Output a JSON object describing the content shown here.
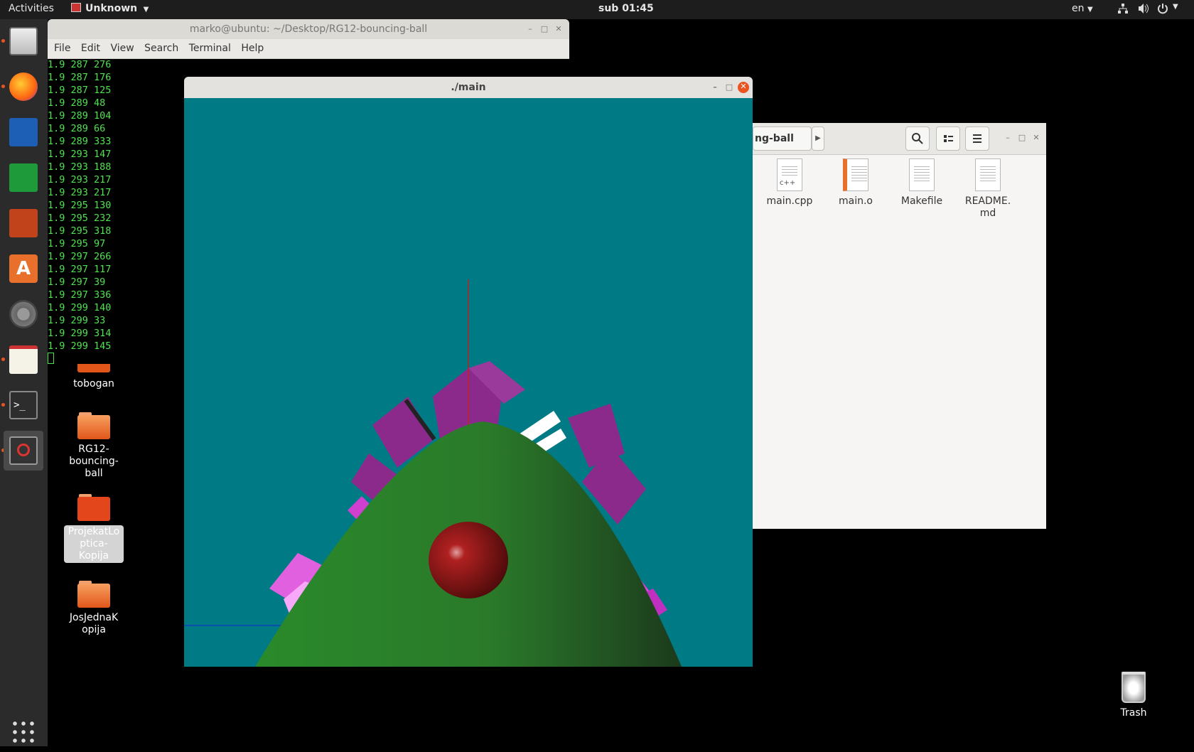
{
  "topbar": {
    "activities": "Activities",
    "app_menu": "Unknown",
    "clock": "sub 01:45",
    "lang": "en"
  },
  "dock": {
    "items": [
      "files",
      "firefox",
      "writer",
      "calc",
      "impress",
      "software",
      "settings",
      "text-editor",
      "terminal",
      "unknown-app",
      "show-apps"
    ]
  },
  "desktop": {
    "icons": [
      {
        "label": "tobogan"
      },
      {
        "label": "RG12-\nbouncing-\nball"
      },
      {
        "label": "ProjekatLo\nptica-\nKopija"
      },
      {
        "label": "JosJednaK\nopija"
      }
    ],
    "trash": "Trash"
  },
  "terminal": {
    "title": "marko@ubuntu: ~/Desktop/RG12-bouncing-ball",
    "menu": [
      "File",
      "Edit",
      "View",
      "Search",
      "Terminal",
      "Help"
    ],
    "lines": [
      "1.9 287 276",
      "1.9 287 176",
      "1.9 287 125",
      "1.9 289 48",
      "1.9 289 104",
      "1.9 289 66",
      "1.9 289 333",
      "1.9 293 147",
      "1.9 293 188",
      "1.9 293 217",
      "1.9 293 217",
      "1.9 295 130",
      "1.9 295 232",
      "1.9 295 318",
      "1.9 295 97",
      "1.9 297 266",
      "1.9 297 117",
      "1.9 297 39",
      "1.9 297 336",
      "1.9 299 140",
      "1.9 299 33",
      "1.9 299 314",
      "1.9 299 145"
    ]
  },
  "files": {
    "path_label": "ng-ball",
    "items": [
      {
        "name": "main.cpp",
        "badge": "c++"
      },
      {
        "name": "main.o"
      },
      {
        "name": "Makefile"
      },
      {
        "name": "README.\nmd"
      }
    ]
  },
  "mainwin": {
    "title": "./main"
  },
  "colors": {
    "scene_bg": "#007b85",
    "hill": "#2a8a2a",
    "block": "#8c2a8c",
    "ball": "#a01a1a",
    "terminal_text": "#4ee44e"
  }
}
